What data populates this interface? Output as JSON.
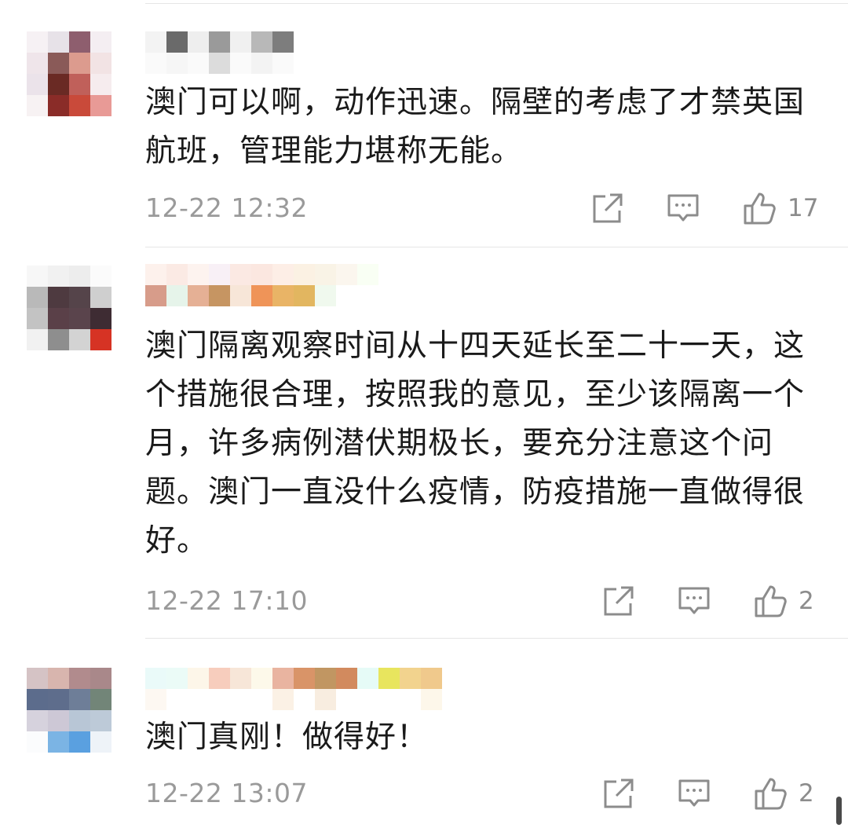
{
  "comments": [
    {
      "text": "澳门可以啊，动作迅速。隔壁的考虑了才禁英国航班，管理能力堪称无能。",
      "time": "12-22 12:32",
      "likes": "17"
    },
    {
      "text": "澳门隔离观察时间从十四天延长至二十一天，这个措施很合理，按照我的意见，至少该隔离一个月，许多病例潜伏期极长，要充分注意这个问题。澳门一直没什么疫情，防疫措施一直做得很好。",
      "time": "12-22 17:10",
      "likes": "2"
    },
    {
      "text": "澳门真刚！做得好！",
      "time": "12-22 13:07",
      "likes": "2"
    }
  ],
  "icons": {
    "share": "share-icon",
    "reply": "comment-icon",
    "like": "thumbs-up-icon"
  },
  "colors": {
    "text": "#1a1a1a",
    "meta": "#9a9a9a",
    "icon": "#8c8c8c",
    "divider": "#e6e6e6"
  }
}
